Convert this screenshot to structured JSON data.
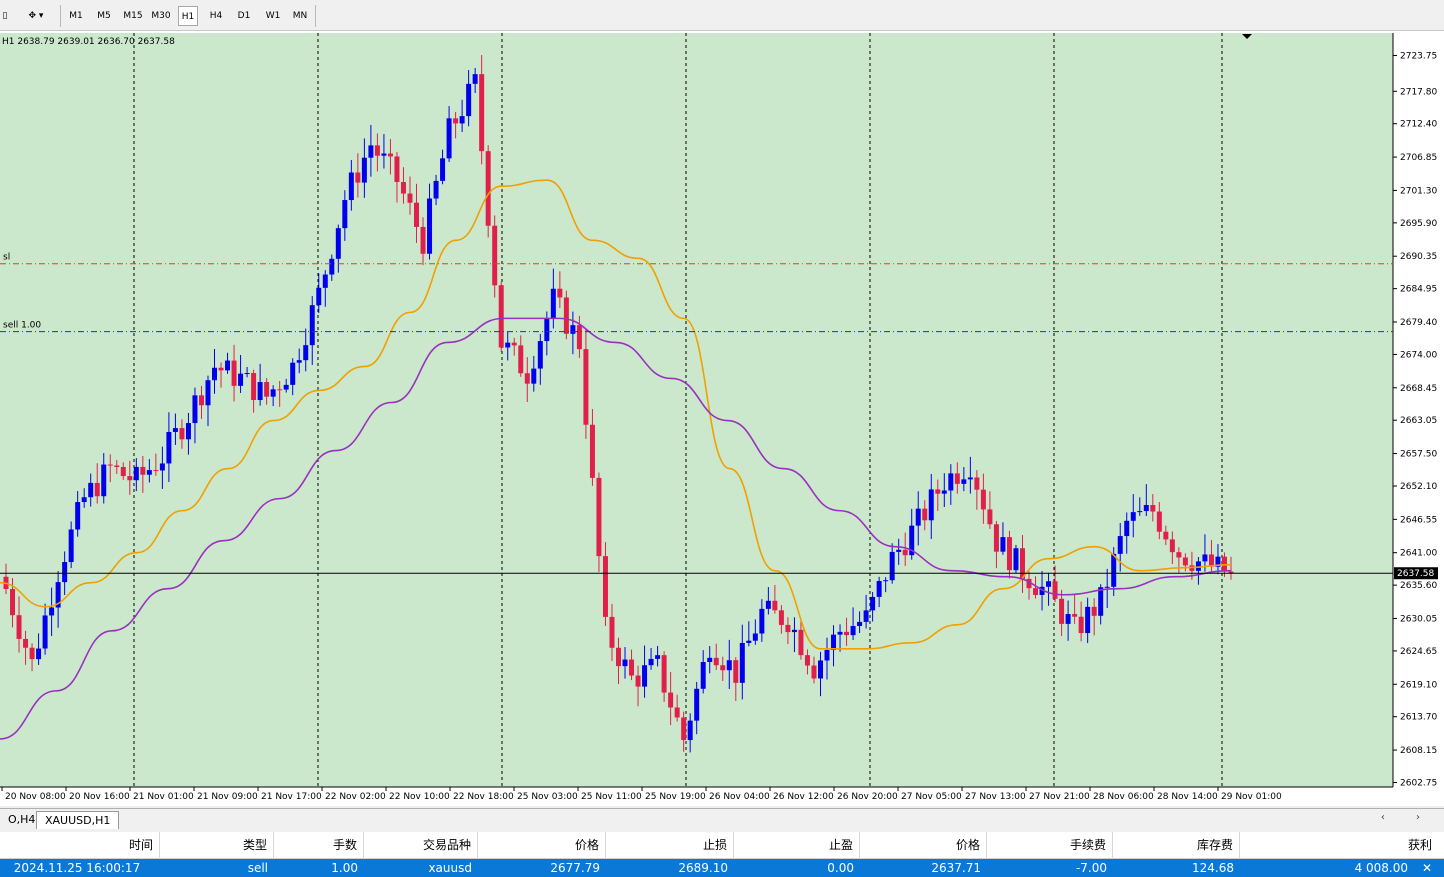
{
  "toolbar": {
    "timeframes": [
      "M1",
      "M5",
      "M15",
      "M30",
      "H1",
      "H4",
      "D1",
      "W1",
      "MN"
    ],
    "active_timeframe": "H1"
  },
  "chart": {
    "header_text": "H1  2638.79 2639.01 2636.70 2637.58",
    "symbol": "XAUUSD",
    "timeframe": "H1",
    "current_price_label": "2637.58",
    "sl_label": "sl",
    "order_label": "sell 1.00",
    "colors": {
      "background": "#cce8cc",
      "bull": "#0000ee",
      "bear": "#e0204a",
      "ma_fast": "#f0a000",
      "ma_slow": "#9a30c0",
      "sl_line": "#e04020",
      "order_line": "#1a30c0",
      "grid": "#000000"
    }
  },
  "chart_data": {
    "type": "candlestick",
    "symbol": "XAUUSD",
    "timeframe": "H1",
    "y_ticks": [
      "2723.75",
      "2717.80",
      "2712.40",
      "2706.85",
      "2701.30",
      "2695.90",
      "2690.35",
      "2684.95",
      "2679.40",
      "2674.00",
      "2668.45",
      "2663.05",
      "2657.50",
      "2652.10",
      "2646.55",
      "2641.00",
      "2635.60",
      "2630.05",
      "2624.65",
      "2619.10",
      "2613.70",
      "2608.15",
      "2602.75"
    ],
    "x_labels": [
      "20 Nov 08:00",
      "20 Nov 16:00",
      "21 Nov 01:00",
      "21 Nov 09:00",
      "21 Nov 17:00",
      "22 Nov 02:00",
      "22 Nov 10:00",
      "22 Nov 18:00",
      "25 Nov 03:00",
      "25 Nov 11:00",
      "25 Nov 19:00",
      "26 Nov 04:00",
      "26 Nov 12:00",
      "26 Nov 20:00",
      "27 Nov 05:00",
      "27 Nov 13:00",
      "27 Nov 21:00",
      "28 Nov 06:00",
      "28 Nov 14:00",
      "29 Nov 01:00"
    ],
    "ylim": [
      2602.0,
      2727.5
    ],
    "horizontal_lines": {
      "sl": 2689.1,
      "sell_entry": 2677.79,
      "current": 2637.58
    },
    "ohlc_anchor_closes": [
      2635.0,
      2622.5,
      2638.0,
      2650.0,
      2655.0,
      2653.0,
      2657.0,
      2664.0,
      2672.0,
      2670.0,
      2667.0,
      2672.0,
      2684.0,
      2700.0,
      2709.0,
      2703.0,
      2693.0,
      2711.0,
      2719.0,
      2676.0,
      2671.0,
      2683.0,
      2676.0,
      2628.0,
      2620.0,
      2622.0,
      2610.0,
      2626.0,
      2621.0,
      2631.0,
      2630.0,
      2622.0,
      2628.0,
      2630.0,
      2640.0,
      2646.0,
      2653.0,
      2656.0,
      2643.0,
      2638.0,
      2634.0,
      2628.0,
      2633.0,
      2646.0,
      2648.0,
      2641.0,
      2639.0,
      2637.58
    ],
    "ma_fast_anchors": [
      2636,
      2632,
      2636,
      2641,
      2648,
      2655,
      2663,
      2668,
      2672,
      2681,
      2693,
      2702,
      2703,
      2693,
      2690,
      2680,
      2655,
      2638,
      2625,
      2625,
      2626,
      2629,
      2635,
      2640,
      2642,
      2638,
      2638.5,
      2639
    ],
    "ma_slow_anchors": [
      2610,
      2618,
      2628,
      2635,
      2643,
      2650,
      2658,
      2666,
      2676,
      2680,
      2680,
      2676,
      2670,
      2663,
      2655,
      2648,
      2642,
      2638,
      2637,
      2634,
      2635,
      2637,
      2638
    ]
  },
  "tabs": [
    "O,H4",
    "XAUUSD,H1"
  ],
  "active_tab": "XAUUSD,H1",
  "terminal": {
    "headers": [
      "时间",
      "类型",
      "手数",
      "交易品种",
      "价格",
      "止损",
      "止盈",
      "价格",
      "手续费",
      "库存费",
      "获利"
    ],
    "rows": [
      [
        "2024.11.25 16:00:17",
        "sell",
        "1.00",
        "xauusd",
        "2677.79",
        "2689.10",
        "0.00",
        "2637.71",
        "-7.00",
        "124.68",
        "4 008.00"
      ]
    ]
  }
}
